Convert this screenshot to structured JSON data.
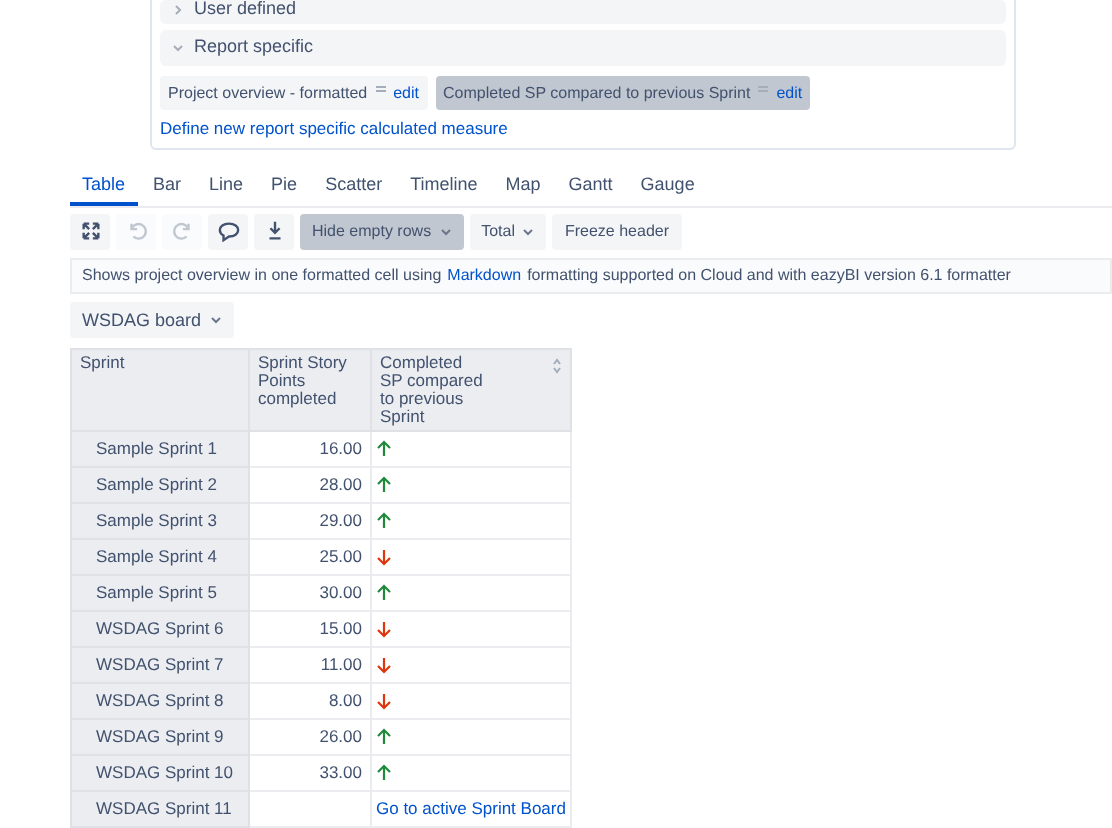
{
  "measures_panel": {
    "sections": [
      {
        "title": "User defined",
        "expanded": false
      },
      {
        "title": "Report specific",
        "expanded": true
      }
    ],
    "measures": [
      {
        "label": "Project overview - formatted",
        "edit": "edit",
        "selected": false
      },
      {
        "label": "Completed SP compared to previous Sprint",
        "edit": "edit",
        "selected": true
      }
    ],
    "define_link": "Define new report specific calculated measure"
  },
  "tabs": [
    {
      "label": "Table",
      "selected": true
    },
    {
      "label": "Bar",
      "selected": false
    },
    {
      "label": "Line",
      "selected": false
    },
    {
      "label": "Pie",
      "selected": false
    },
    {
      "label": "Scatter",
      "selected": false
    },
    {
      "label": "Timeline",
      "selected": false
    },
    {
      "label": "Map",
      "selected": false
    },
    {
      "label": "Gantt",
      "selected": false
    },
    {
      "label": "Gauge",
      "selected": false
    }
  ],
  "toolbar": {
    "icons": [
      {
        "kind": "expand",
        "disabled": false
      },
      {
        "kind": "undo",
        "disabled": true
      },
      {
        "kind": "redo",
        "disabled": true
      },
      {
        "kind": "comment",
        "disabled": false
      },
      {
        "kind": "download",
        "disabled": false
      }
    ],
    "buttons": [
      {
        "label": "Hide empty rows",
        "dropdown": true,
        "selected": true
      },
      {
        "label": "Total",
        "dropdown": true,
        "selected": false
      },
      {
        "label": "Freeze header",
        "dropdown": false,
        "selected": false
      }
    ]
  },
  "description": [
    {
      "kind": "text",
      "text": "Shows project overview in one formatted cell using"
    },
    {
      "kind": "link",
      "text": "Markdown"
    },
    {
      "kind": "text",
      "text": "formatting supported on Cloud and with eazyBI version 6.1 formatter"
    }
  ],
  "page_filter": "WSDAG board",
  "table": {
    "columns": [
      "Sprint",
      "Sprint Story Points completed",
      "Completed SP compared to previous Sprint"
    ],
    "rows": [
      {
        "sprint": "Sample Sprint 1",
        "points": "16.00",
        "kind": "up"
      },
      {
        "sprint": "Sample Sprint 2",
        "points": "28.00",
        "kind": "up"
      },
      {
        "sprint": "Sample Sprint 3",
        "points": "29.00",
        "kind": "up"
      },
      {
        "sprint": "Sample Sprint 4",
        "points": "25.00",
        "kind": "down"
      },
      {
        "sprint": "Sample Sprint 5",
        "points": "30.00",
        "kind": "up"
      },
      {
        "sprint": "WSDAG Sprint 6",
        "points": "15.00",
        "kind": "down"
      },
      {
        "sprint": "WSDAG Sprint 7",
        "points": "11.00",
        "kind": "down"
      },
      {
        "sprint": "WSDAG Sprint 8",
        "points": "8.00",
        "kind": "down"
      },
      {
        "sprint": "WSDAG Sprint 9",
        "points": "26.00",
        "kind": "up"
      },
      {
        "sprint": "WSDAG Sprint 10",
        "points": "33.00",
        "kind": "up"
      },
      {
        "sprint": "WSDAG Sprint 11",
        "kind": "link",
        "link": "Go to active Sprint Board"
      }
    ]
  }
}
